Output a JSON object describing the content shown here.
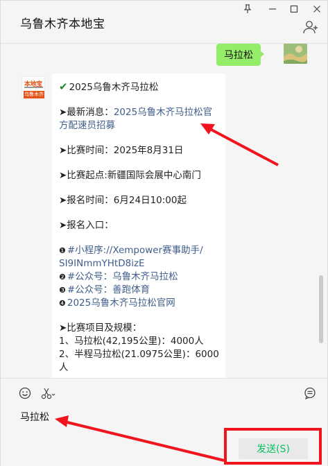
{
  "window": {
    "title": "乌鲁木齐本地宝",
    "controls": {
      "pin": "⚲",
      "minimize": "—",
      "maximize": "☐",
      "close": "✕"
    }
  },
  "chat": {
    "self_message": "马拉松",
    "bot_logo_top": "本地宝",
    "bot_logo_bar": "乌鲁木齐",
    "bot_message": {
      "title": "2025乌鲁木齐马拉松",
      "news_label": "➤最新消息：",
      "news_link_1": "2025乌鲁木齐马拉松官",
      "news_link_2": "方配速员招募",
      "time": "➤比赛时间：2025年8月31日",
      "start": "➤比赛起点:新疆国际会展中心南门",
      "signup_time": "➤报名时间：6月24日10:00起",
      "entry_label": "➤报名入口：",
      "entry_1_bullet": "❶",
      "entry_1a": "#小程序://Xempower赛事助手/",
      "entry_1b": "SI9INmmYHtD8izE",
      "entry_2_bullet": "❷",
      "entry_2": "#公众号：乌鲁木齐马拉松",
      "entry_3_bullet": "❸",
      "entry_3": "#公众号：善跑体育",
      "entry_4_bullet": "❹",
      "entry_4": "2025乌鲁木齐马拉松官网",
      "events_label": "➤比赛项目及规模：",
      "event_1": "1、马拉松(42,195公里)：4000人",
      "event_2": "2、半程马拉松(21.0975公里)：6000",
      "event_2_cont": "人"
    }
  },
  "input": {
    "text": "马拉松",
    "send_label": "发送(S)"
  },
  "colors": {
    "accent_green": "#07c160",
    "self_bubble": "#95ec69",
    "link": "#3f5e8a",
    "annotation_red": "#f0141e"
  }
}
